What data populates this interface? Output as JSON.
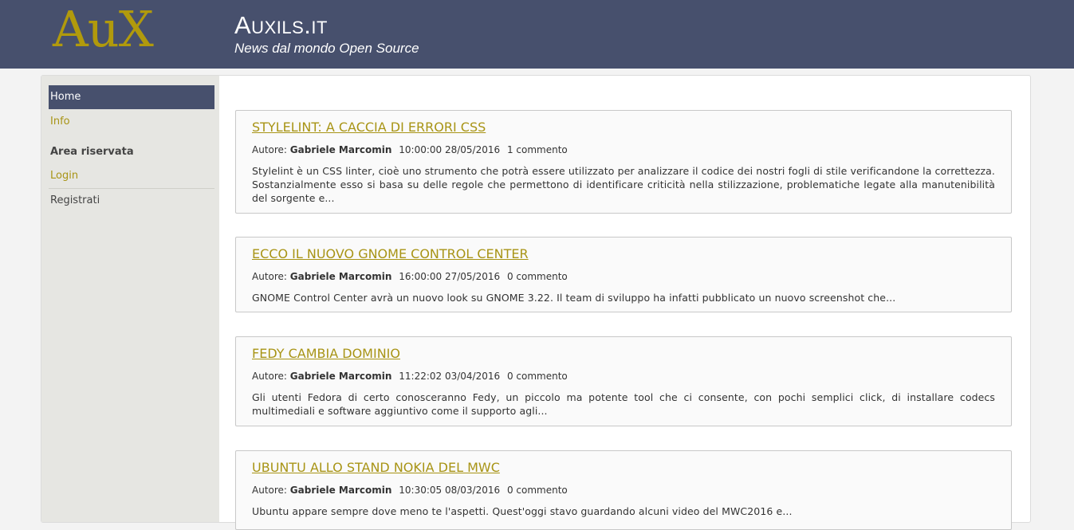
{
  "header": {
    "logo": "AuX",
    "title": "Auxils.it",
    "subtitle": "News dal mondo Open Source"
  },
  "sidebar": {
    "home": "Home",
    "info": "Info",
    "area_heading": "Area riservata",
    "login": "Login",
    "register": "Registrati"
  },
  "articles": [
    {
      "title": "Stylelint: a caccia di errori CSS",
      "author_label": "Autore:",
      "author": "Gabriele Marcomin",
      "datetime": "10:00:00 28/05/2016",
      "comments": "1 commento",
      "excerpt": "Stylelint è un CSS linter, cioè uno strumento che potrà essere utilizzato per analizzare il codice dei nostri fogli di stile verificandone la correttezza. Sostanzialmente esso si basa su delle regole che permettono di identificare criticità nella stilizzazione, problematiche legate alla manutenibilità del sorgente e..."
    },
    {
      "title": "Ecco il nuovo GNOME Control Center",
      "author_label": "Autore:",
      "author": "Gabriele Marcomin",
      "datetime": "16:00:00 27/05/2016",
      "comments": "0 commento",
      "excerpt": "GNOME Control Center avrà un nuovo look su GNOME 3.22. Il team di sviluppo ha infatti pubblicato un nuovo screenshot che..."
    },
    {
      "title": "Fedy cambia dominio",
      "author_label": "Autore:",
      "author": "Gabriele Marcomin",
      "datetime": "11:22:02 03/04/2016",
      "comments": "0 commento",
      "excerpt": "Gli utenti Fedora di certo conosceranno Fedy, un piccolo ma potente tool che ci consente, con pochi semplici click, di installare codecs multimediali e software aggiuntivo come il supporto agli..."
    },
    {
      "title": "Ubuntu allo stand Nokia del MWC",
      "author_label": "Autore:",
      "author": "Gabriele Marcomin",
      "datetime": "10:30:05 08/03/2016",
      "comments": "0 commento",
      "excerpt": "Ubuntu appare sempre dove meno te l'aspetti. Quest'oggi stavo guardando alcuni video del MWC2016 e..."
    }
  ]
}
